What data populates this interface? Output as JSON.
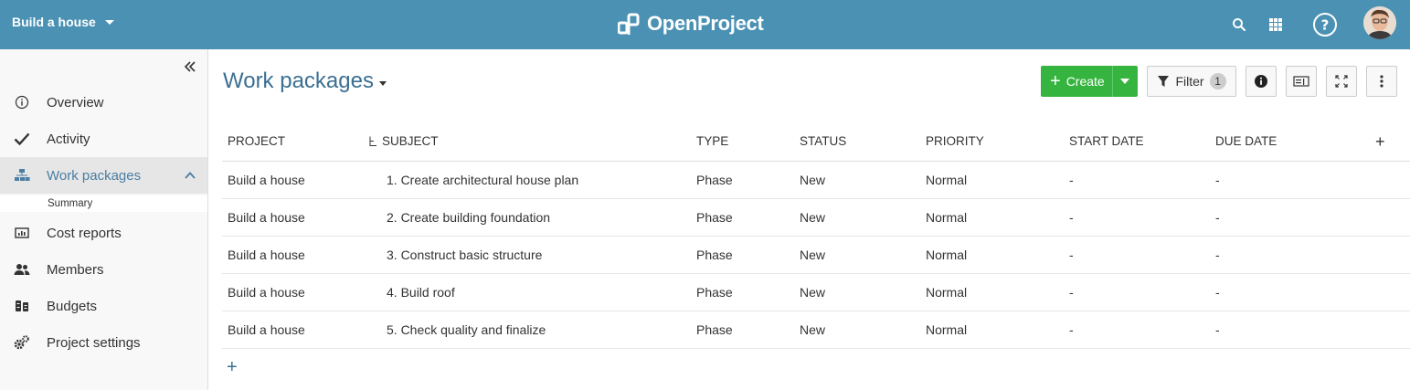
{
  "header": {
    "project_name": "Build a house",
    "logo_text": "OpenProject",
    "icons": [
      "search-icon",
      "modules-grid-icon",
      "help-icon",
      "user-avatar"
    ]
  },
  "sidebar": {
    "items": [
      {
        "label": "Overview",
        "icon": "info-icon"
      },
      {
        "label": "Activity",
        "icon": "checkmark-icon"
      },
      {
        "label": "Work packages",
        "icon": "hierarchy-icon",
        "active": true
      },
      {
        "label": "Cost reports",
        "icon": "cost-reports-icon"
      },
      {
        "label": "Members",
        "icon": "members-icon"
      },
      {
        "label": "Budgets",
        "icon": "budgets-icon"
      },
      {
        "label": "Project settings",
        "icon": "settings-icon"
      }
    ],
    "sub_item": "Summary"
  },
  "main": {
    "title": "Work packages",
    "toolbar": {
      "create_label": "Create",
      "filter_label": "Filter",
      "filter_count": "1"
    },
    "columns": [
      "PROJECT",
      "SUBJECT",
      "TYPE",
      "STATUS",
      "PRIORITY",
      "START DATE",
      "DUE DATE"
    ],
    "rows": [
      {
        "project": "Build a house",
        "subject": "1. Create architectural house plan",
        "type": "Phase",
        "status": "New",
        "priority": "Normal",
        "start": "-",
        "due": "-"
      },
      {
        "project": "Build a house",
        "subject": "2. Create building foundation",
        "type": "Phase",
        "status": "New",
        "priority": "Normal",
        "start": "-",
        "due": "-"
      },
      {
        "project": "Build a house",
        "subject": "3. Construct basic structure",
        "type": "Phase",
        "status": "New",
        "priority": "Normal",
        "start": "-",
        "due": "-"
      },
      {
        "project": "Build a house",
        "subject": "4. Build roof",
        "type": "Phase",
        "status": "New",
        "priority": "Normal",
        "start": "-",
        "due": "-"
      },
      {
        "project": "Build a house",
        "subject": "5. Check quality and finalize",
        "type": "Phase",
        "status": "New",
        "priority": "Normal",
        "start": "-",
        "due": "-"
      }
    ]
  },
  "colors": {
    "header_bg": "#4a91b3",
    "accent": "#3b6f91",
    "create_green": "#35b53f"
  }
}
